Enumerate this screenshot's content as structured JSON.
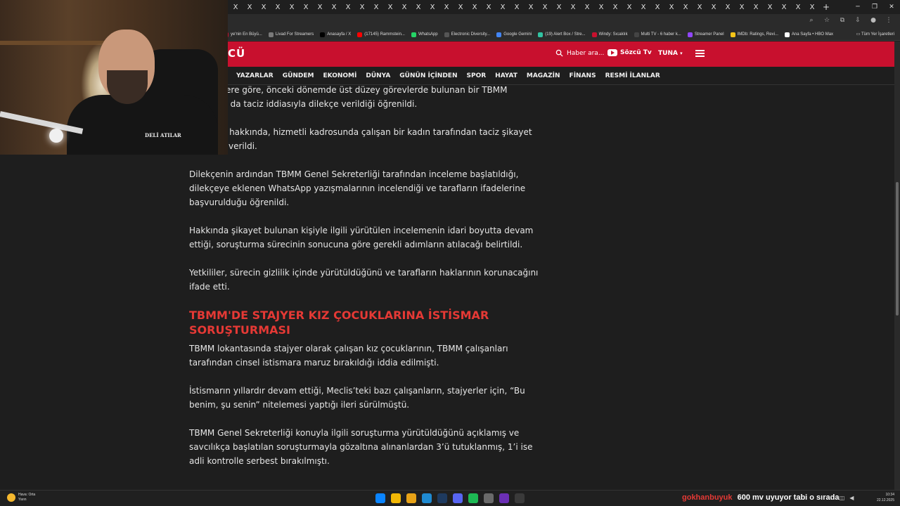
{
  "browser": {
    "tab_close_glyph": "X",
    "new_tab": "+",
    "bookmarks": [
      {
        "label": "ye'nin En Büyü...",
        "color": "#c8102e"
      },
      {
        "label": "Livad For Streamers",
        "color": "#7a7a7a"
      },
      {
        "label": "Anasayfa / X",
        "color": "#000000"
      },
      {
        "label": "(17145) Rammstein...",
        "color": "#ff0000"
      },
      {
        "label": "WhatsApp",
        "color": "#25d366"
      },
      {
        "label": "Electronic Diversity...",
        "color": "#555555"
      },
      {
        "label": "Google Gemini",
        "color": "#4285f4"
      },
      {
        "label": "(19) Alert Box / Stre...",
        "color": "#31c3a2"
      },
      {
        "label": "Windy: Sıcaklık",
        "color": "#c8102e"
      },
      {
        "label": "Multi TV - 6 haber k...",
        "color": "#444444"
      },
      {
        "label": "Streamer Panel",
        "color": "#9146ff"
      },
      {
        "label": "IMDb: Ratings, Revi...",
        "color": "#f5c518"
      },
      {
        "label": "Ana Sayfa • HBO Max",
        "color": "#ffffff"
      }
    ],
    "bookmark_folder": "Tüm Yer İşaretleri"
  },
  "site": {
    "logo": "CÜ",
    "search_placeholder": "Haber ara...",
    "youtube_label": "Sözcü Tv",
    "user_name": "TUNA",
    "user_caret": "▾",
    "nav": [
      "YAZARLAR",
      "GÜNDEM",
      "EKONOMİ",
      "DÜNYA",
      "GÜNÜN İÇİNDEN",
      "SPOR",
      "HAYAT",
      "MAGAZİN",
      "FİNANS",
      "RESMİ İLANLAR"
    ]
  },
  "article": {
    "p1": "alan habere göre, önceki dönemde üst düzey görevlerde bulunan bir TBMM hakkında da taciz iddiasıyla dilekçe verildiği öğrenildi.",
    "p2": "u çalışan hakkında, hizmetli kadrosunda çalışan bir kadın tarafından taciz şikayet dilekçesi verildi.",
    "p3": "Dilekçenin ardından TBMM Genel Sekreterliği tarafından inceleme başlatıldığı, dilekçeye eklenen WhatsApp yazışmalarının incelendiği ve tarafların ifadelerine başvurulduğu öğrenildi.",
    "p4": "Hakkında şikayet bulunan kişiyle ilgili yürütülen incelemenin idari boyutta devam ettiği, soruşturma sürecinin sonucuna göre gerekli adımların atılacağı belirtildi.",
    "p5": "Yetkililer, sürecin gizlilik içinde yürütüldüğünü ve tarafların haklarının korunacağını ifade etti.",
    "heading": "TBMM'DE STAJYER KIZ ÇOCUKLARINA İSTİSMAR SORUŞTURMASI",
    "p6": "TBMM lokantasında stajyer olarak çalışan kız çocuklarının, TBMM çalışanları tarafından cinsel istismara maruz bırakıldığı iddia edilmişti.",
    "p7": "İstismarın yıllardır devam ettiği, Meclis’teki bazı çalışanların, stajyerler için, “Bu benim, şu senin” nitelemesi yaptığı ileri sürülmüştü.",
    "p8": "TBMM Genel Sekreterliği konuyla ilgili soruşturma yürütüldüğünü açıklamış ve savcılıkça başlatılan soruşturmayla gözaltına alınanlardan 3’ü tutuklanmış, 1’i ise adli kontrolle serbest bırakılmıştı."
  },
  "webcam": {
    "shirt_logo": "DELİ ATILAR"
  },
  "taskbar": {
    "weather_title": "Hava: Orta",
    "weather_sub": "Yarın",
    "ticker_user": "gokhanbuyuk",
    "ticker_msg": "600 mv uyuyor tabi o sırada",
    "time": "10:34",
    "date": "22.12.2025",
    "app_colors": [
      "#0a84ff",
      "#f2b705",
      "#e8a317",
      "#1f8ad1",
      "#1e3a5f",
      "#5865f2",
      "#1db954",
      "#6a6a6a",
      "#6b2fb5",
      "#3a3a3a"
    ]
  }
}
